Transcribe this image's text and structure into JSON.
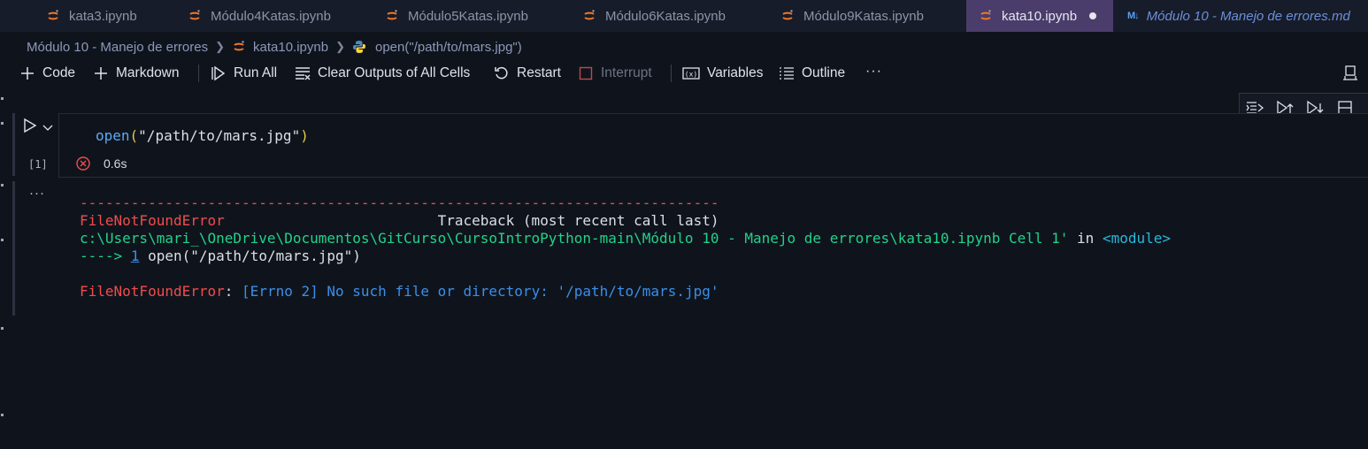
{
  "tabs": [
    {
      "label": "kata3.ipynb",
      "type": "jupyter"
    },
    {
      "label": "Módulo4Katas.ipynb",
      "type": "jupyter"
    },
    {
      "label": "Módulo5Katas.ipynb",
      "type": "jupyter"
    },
    {
      "label": "Módulo6Katas.ipynb",
      "type": "jupyter"
    },
    {
      "label": "Módulo9Katas.ipynb",
      "type": "jupyter"
    },
    {
      "label": "kata10.ipynb",
      "type": "jupyter",
      "active": true,
      "dirty": true
    },
    {
      "label": "Módulo 10 - Manejo de errores.md",
      "type": "markdown",
      "icon_text": "M↓"
    }
  ],
  "breadcrumb": {
    "folder": "Módulo 10 - Manejo de errores",
    "file": "kata10.ipynb",
    "symbol": "open(\"/path/to/mars.jpg\")"
  },
  "toolbar": {
    "code": "Code",
    "markdown": "Markdown",
    "run_all": "Run All",
    "clear_outputs": "Clear Outputs of All Cells",
    "restart": "Restart",
    "interrupt": "Interrupt",
    "variables": "Variables",
    "outline": "Outline",
    "more": "···"
  },
  "cell": {
    "code": {
      "fn": "open",
      "open_paren": "(",
      "arg": "\"/path/to/mars.jpg\"",
      "close_paren": ")"
    },
    "execution_count": "[1]",
    "duration": "0.6s",
    "output_more": "···"
  },
  "output": {
    "dashes": "---------------------------------------------------------------------------",
    "error_name": "FileNotFoundError",
    "traceback_header": "Traceback (most recent call last)",
    "path": "c:\\Users\\mari_\\OneDrive\\Documentos\\GitCurso\\CursoIntroPython-main\\Módulo 10 - Manejo de errores\\kata10.ipynb Cell 1'",
    "in_text": "in",
    "module": "<module>",
    "arrow": "---->",
    "line_no": "1",
    "line_code": "open(\"/path/to/mars.jpg\")",
    "final_error": "FileNotFoundError",
    "final_colon": ":",
    "final_message": "[Errno 2] No such file or directory: '/path/to/mars.jpg'"
  },
  "colors": {
    "tab_active_bg": "#4a3d6b",
    "error_red": "#f14c4c",
    "path_green": "#23d18b",
    "module_cyan": "#29b8db",
    "message_blue": "#3b8eea",
    "jupyter_orange": "#f37726"
  }
}
